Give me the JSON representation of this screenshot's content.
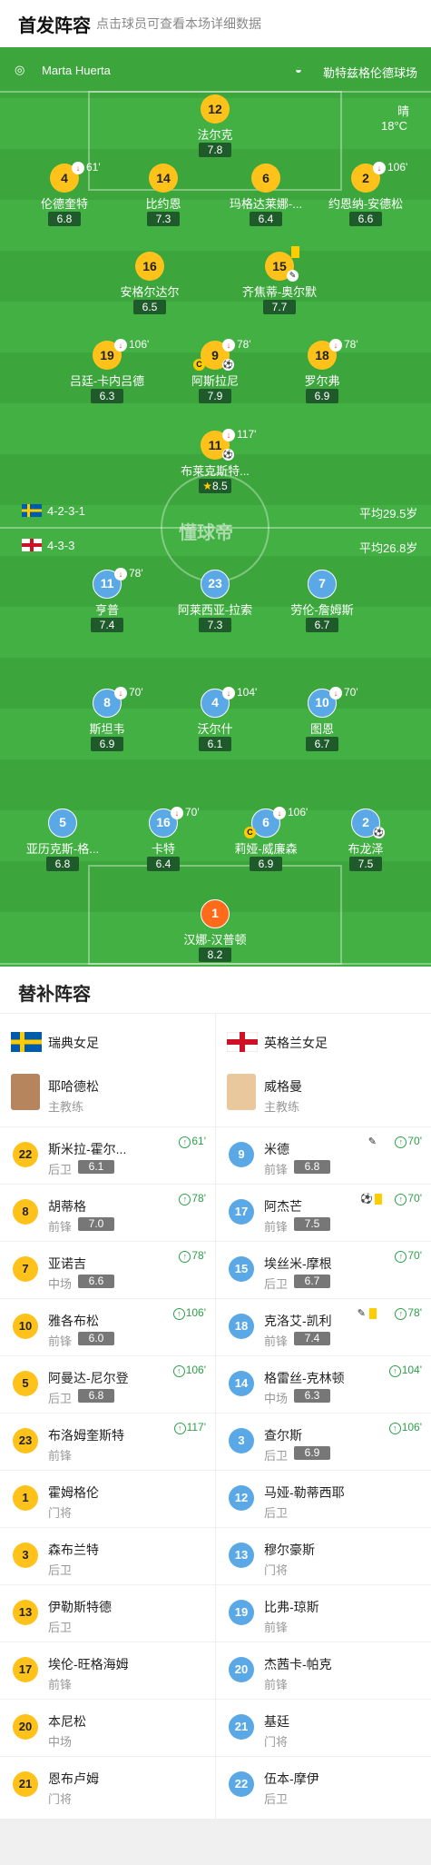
{
  "header": {
    "title": "首发阵容",
    "subtitle": "点击球员可查看本场详细数据"
  },
  "match": {
    "referee": "Marta Huerta",
    "stadium": "勒特兹格伦德球场",
    "weather": "晴",
    "temperature": "18°C"
  },
  "watermark": "懂球帝",
  "sweden": {
    "formation": "4-2-3-1",
    "avg_age": "平均29.5岁",
    "name": "瑞典女足",
    "color": "#ffc21a",
    "players": [
      {
        "num": "12",
        "name": "法尔克",
        "rating": "7.8"
      },
      {
        "num": "4",
        "name": "伦德奎特",
        "rating": "6.8",
        "sub": "61'"
      },
      {
        "num": "14",
        "name": "比约恩",
        "rating": "7.3"
      },
      {
        "num": "6",
        "name": "玛格达莱娜-...",
        "rating": "6.4"
      },
      {
        "num": "2",
        "name": "约恩纳-安德松",
        "rating": "6.6",
        "sub": "106'"
      },
      {
        "num": "16",
        "name": "安格尔达尔",
        "rating": "6.5"
      },
      {
        "num": "15",
        "name": "齐焦蒂-奥尔默",
        "rating": "7.7"
      },
      {
        "num": "19",
        "name": "吕廷-卡内吕德",
        "rating": "6.3",
        "sub": "106'"
      },
      {
        "num": "9",
        "name": "阿斯拉尼",
        "rating": "7.9",
        "sub": "78'"
      },
      {
        "num": "18",
        "name": "罗尔弗",
        "rating": "6.9",
        "sub": "78'"
      },
      {
        "num": "11",
        "name": "布莱克斯特...",
        "rating": "8.5",
        "sub": "117'"
      }
    ],
    "coach": {
      "name": "耶哈德松",
      "role": "主教练"
    },
    "bench": [
      {
        "num": "22",
        "name": "斯米拉-霍尔...",
        "pos": "后卫",
        "rating": "6.1",
        "min": "61'"
      },
      {
        "num": "8",
        "name": "胡蒂格",
        "pos": "前锋",
        "rating": "7.0",
        "min": "78'"
      },
      {
        "num": "7",
        "name": "亚诺吉",
        "pos": "中场",
        "rating": "6.6",
        "min": "78'"
      },
      {
        "num": "10",
        "name": "雅各布松",
        "pos": "前锋",
        "rating": "6.0",
        "min": "106'"
      },
      {
        "num": "5",
        "name": "阿曼达-尼尔登",
        "pos": "后卫",
        "rating": "6.8",
        "min": "106'"
      },
      {
        "num": "23",
        "name": "布洛姆奎斯特",
        "pos": "前锋",
        "rating": "",
        "min": "117'"
      },
      {
        "num": "1",
        "name": "霍姆格伦",
        "pos": "门将",
        "rating": "",
        "min": ""
      },
      {
        "num": "3",
        "name": "森布兰特",
        "pos": "后卫",
        "rating": "",
        "min": ""
      },
      {
        "num": "13",
        "name": "伊勒斯特德",
        "pos": "后卫",
        "rating": "",
        "min": ""
      },
      {
        "num": "17",
        "name": "埃伦-旺格海姆",
        "pos": "前锋",
        "rating": "",
        "min": ""
      },
      {
        "num": "20",
        "name": "本尼松",
        "pos": "中场",
        "rating": "",
        "min": ""
      },
      {
        "num": "21",
        "name": "恩布卢姆",
        "pos": "门将",
        "rating": "",
        "min": ""
      }
    ]
  },
  "england": {
    "formation": "4-3-3",
    "avg_age": "平均26.8岁",
    "name": "英格兰女足",
    "color": "#5aa9e6",
    "players": [
      {
        "num": "11",
        "name": "亨普",
        "rating": "7.4",
        "sub": "78'"
      },
      {
        "num": "23",
        "name": "阿莱西亚-拉索",
        "rating": "7.3"
      },
      {
        "num": "7",
        "name": "劳伦-詹姆斯",
        "rating": "6.7"
      },
      {
        "num": "8",
        "name": "斯坦韦",
        "rating": "6.9",
        "sub": "70'"
      },
      {
        "num": "4",
        "name": "沃尔什",
        "rating": "6.1",
        "sub": "104'"
      },
      {
        "num": "10",
        "name": "图恩",
        "rating": "6.7",
        "sub": "70'"
      },
      {
        "num": "5",
        "name": "亚历克斯-格...",
        "rating": "6.8"
      },
      {
        "num": "16",
        "name": "卡特",
        "rating": "6.4",
        "sub": "70'"
      },
      {
        "num": "6",
        "name": "莉娅-威廉森",
        "rating": "6.9",
        "sub": "106'"
      },
      {
        "num": "2",
        "name": "布龙泽",
        "rating": "7.5"
      },
      {
        "num": "1",
        "name": "汉娜-汉普顿",
        "rating": "8.2"
      }
    ],
    "coach": {
      "name": "威格曼",
      "role": "主教练"
    },
    "bench": [
      {
        "num": "9",
        "name": "米德",
        "pos": "前锋",
        "rating": "6.8",
        "min": "70'"
      },
      {
        "num": "17",
        "name": "阿杰芒",
        "pos": "前锋",
        "rating": "7.5",
        "min": "70'"
      },
      {
        "num": "15",
        "name": "埃丝米-摩根",
        "pos": "后卫",
        "rating": "6.7",
        "min": "70'"
      },
      {
        "num": "18",
        "name": "克洛艾-凯利",
        "pos": "前锋",
        "rating": "7.4",
        "min": "78'"
      },
      {
        "num": "14",
        "name": "格雷丝-克林顿",
        "pos": "中场",
        "rating": "6.3",
        "min": "104'"
      },
      {
        "num": "3",
        "name": "查尔斯",
        "pos": "后卫",
        "rating": "6.9",
        "min": "106'"
      },
      {
        "num": "12",
        "name": "马娅-勒蒂西耶",
        "pos": "后卫",
        "rating": "",
        "min": ""
      },
      {
        "num": "13",
        "name": "穆尔豪斯",
        "pos": "门将",
        "rating": "",
        "min": ""
      },
      {
        "num": "19",
        "name": "比弗-琼斯",
        "pos": "前锋",
        "rating": "",
        "min": ""
      },
      {
        "num": "20",
        "name": "杰茜卡-帕克",
        "pos": "前锋",
        "rating": "",
        "min": ""
      },
      {
        "num": "21",
        "name": "基廷",
        "pos": "门将",
        "rating": "",
        "min": ""
      },
      {
        "num": "22",
        "name": "伍本-摩伊",
        "pos": "后卫",
        "rating": "",
        "min": ""
      }
    ]
  },
  "bench_title": "替补阵容"
}
